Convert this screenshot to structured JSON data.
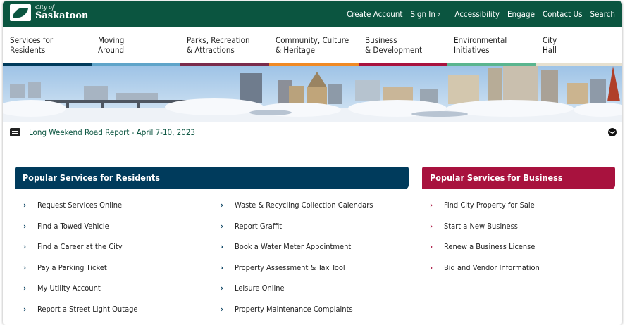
{
  "brand": {
    "city": "City of",
    "name": "Saskatoon"
  },
  "toplinks": [
    {
      "label": "Create Account"
    },
    {
      "label": "Sign In ›"
    },
    {
      "label": "Accessibility"
    },
    {
      "label": "Engage"
    },
    {
      "label": "Contact Us"
    },
    {
      "label": "Search"
    }
  ],
  "nav": [
    {
      "line1": "Services for",
      "line2": "Residents",
      "color": "#003b5c"
    },
    {
      "line1": "Moving",
      "line2": "Around",
      "color": "#5fa4c9"
    },
    {
      "line1": "Parks, Recreation",
      "line2": "& Attractions",
      "color": "#7a2b4b"
    },
    {
      "line1": "Community, Culture",
      "line2": "& Heritage",
      "color": "#f08a24"
    },
    {
      "line1": "Business",
      "line2": "& Development",
      "color": "#a8123e"
    },
    {
      "line1": "Environmental",
      "line2": "Initiatives",
      "color": "#5ab58f"
    },
    {
      "line1": "City",
      "line2": "Hall",
      "color": "#e6e0cf"
    }
  ],
  "alert": {
    "text": "Long Weekend Road Report - April 7-10, 2023",
    "toggle": "❯"
  },
  "residents": {
    "title": "Popular Services for Residents",
    "color": "#003b5c",
    "chevron_color": "#003b5c",
    "col1": [
      "Request Services Online",
      "Find a Towed Vehicle",
      "Find a Career at the City",
      "Pay a Parking Ticket",
      "My Utility Account",
      "Report a Street Light Outage"
    ],
    "col2": [
      "Waste & Recycling Collection Calendars",
      "Report Graffiti",
      "Book a Water Meter Appointment",
      "Property Assessment & Tax Tool",
      "Leisure Online",
      "Property Maintenance Complaints"
    ]
  },
  "business": {
    "title": "Popular Services for Business",
    "color": "#a8123e",
    "chevron_color": "#a8123e",
    "items": [
      "Find City Property for Sale",
      "Start a New Business",
      "Renew a Business License",
      "Bid and Vendor Information"
    ]
  },
  "chevron": "›",
  "icons": {
    "alert": "newspaper-icon",
    "toggle": "chevron-down-icon",
    "logo": "city-logo-icon"
  }
}
